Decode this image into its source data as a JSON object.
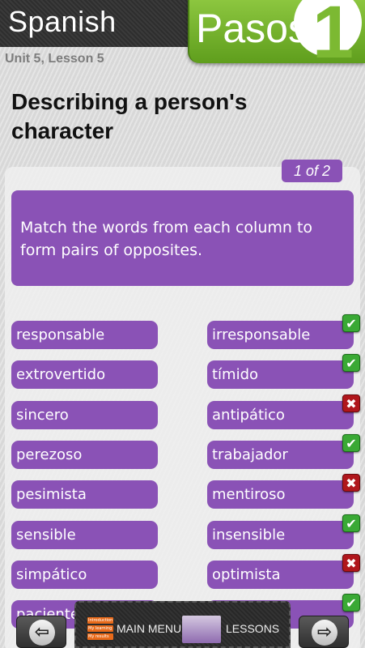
{
  "header": {
    "subject": "Spanish",
    "brand": "Pasos",
    "brand_number": "1"
  },
  "unit": "Unit 5, Lesson 5",
  "lesson_title": "Describing a person's character",
  "counter": "1 of 2",
  "instruction": "Match the words from each column to form pairs of opposites.",
  "colors": {
    "accent_purple": "#8a52b6",
    "brand_green": "#7cb932",
    "correct": "#3aa935",
    "wrong": "#b0161c"
  },
  "pairs": [
    {
      "left": "responsable",
      "right": "irresponsable",
      "result": "correct"
    },
    {
      "left": "extrovertido",
      "right": "tímido",
      "result": "correct"
    },
    {
      "left": "sincero",
      "right": "antipático",
      "result": "wrong"
    },
    {
      "left": "perezoso",
      "right": "trabajador",
      "result": "correct"
    },
    {
      "left": "pesimista",
      "right": "mentiroso",
      "result": "wrong"
    },
    {
      "left": "sensible",
      "right": "insensible",
      "result": "correct"
    },
    {
      "left": "simpático",
      "right": "optimista",
      "result": "wrong"
    },
    {
      "left": "paciente",
      "right": "",
      "result": "correct"
    }
  ],
  "bottom": {
    "menu_label": "MAIN MENU",
    "lessons_label": "LESSONS",
    "menu_thumb_items": [
      "Introduction",
      "My learning",
      "My results"
    ],
    "prev_icon": "arrow-left-icon",
    "next_icon": "arrow-right-icon"
  }
}
